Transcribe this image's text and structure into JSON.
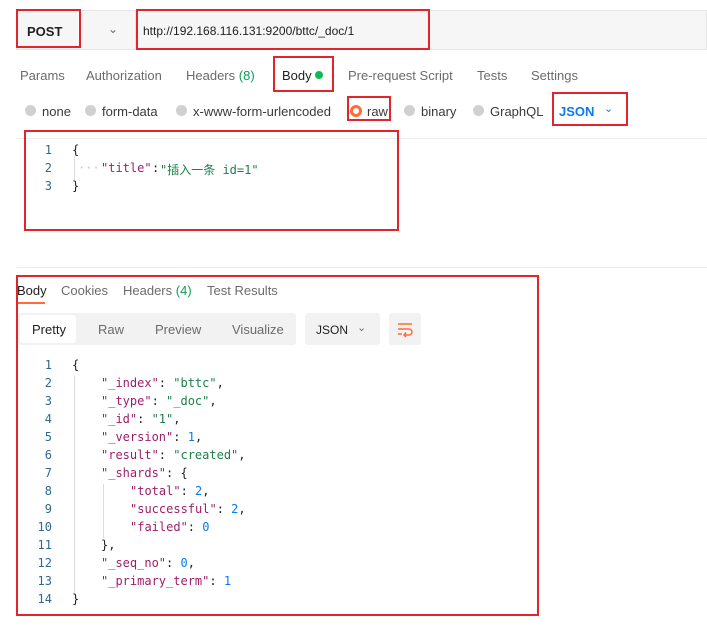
{
  "request": {
    "method": "POST",
    "url": "http://192.168.116.131:9200/bttc/_doc/1"
  },
  "tabs": {
    "params": "Params",
    "authorization": "Authorization",
    "headers": "Headers",
    "headers_count": "(8)",
    "body": "Body",
    "pre_request": "Pre-request Script",
    "tests": "Tests",
    "settings": "Settings"
  },
  "body_types": {
    "none": "none",
    "form_data": "form-data",
    "urlencoded": "x-www-form-urlencoded",
    "raw": "raw",
    "binary": "binary",
    "graphql": "GraphQL",
    "language": "JSON"
  },
  "request_body": {
    "line_numbers": [
      "1",
      "2",
      "3"
    ],
    "open": "{",
    "key": "\"title\"",
    "colon": ":",
    "value": "\"插入一条 id=1\"",
    "close": "}"
  },
  "response_tabs": {
    "body": "Body",
    "cookies": "Cookies",
    "headers": "Headers",
    "headers_count": "(4)",
    "test_results": "Test Results"
  },
  "response_toolbar": {
    "pretty": "Pretty",
    "raw": "Raw",
    "preview": "Preview",
    "visualize": "Visualize",
    "format": "JSON"
  },
  "response_body": {
    "line_numbers": [
      "1",
      "2",
      "3",
      "4",
      "5",
      "6",
      "7",
      "8",
      "9",
      "10",
      "11",
      "12",
      "13",
      "14"
    ],
    "l1": "{",
    "index_key": "\"_index\"",
    "index_val": "\"bttc\"",
    "type_key": "\"_type\"",
    "type_val": "\"_doc\"",
    "id_key": "\"_id\"",
    "id_val": "\"1\"",
    "version_key": "\"_version\"",
    "version_val": "1",
    "result_key": "\"result\"",
    "result_val": "\"created\"",
    "shards_key": "\"_shards\"",
    "shards_open": "{",
    "total_key": "\"total\"",
    "total_val": "2",
    "successful_key": "\"successful\"",
    "successful_val": "2",
    "failed_key": "\"failed\"",
    "failed_val": "0",
    "shards_close": "},",
    "seq_key": "\"_seq_no\"",
    "seq_val": "0",
    "term_key": "\"_primary_term\"",
    "term_val": "1",
    "l14": "}",
    "colon": ": ",
    "comma": ","
  },
  "colors": {
    "accent": "#ff6c37",
    "annotation_red": "#e0262a",
    "link_blue": "#097bed",
    "success_green": "#0cbb52"
  }
}
